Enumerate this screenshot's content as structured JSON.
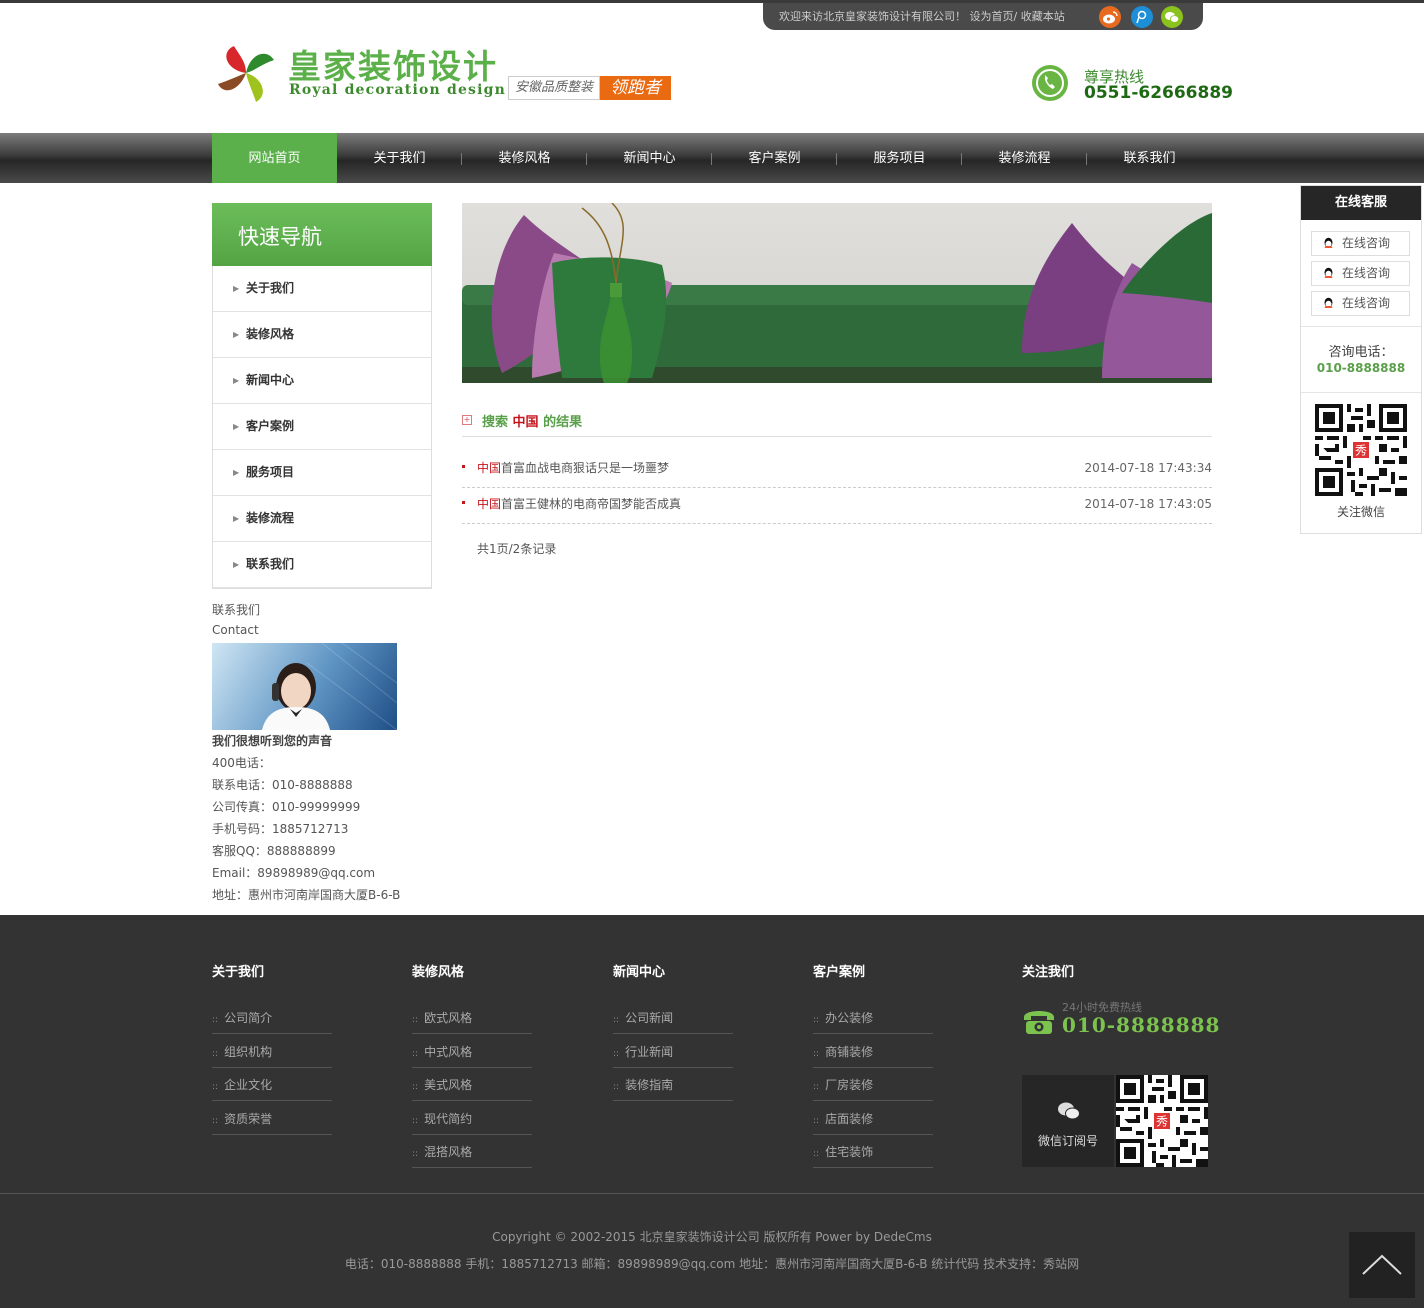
{
  "topbar": {
    "welcome": "欢迎来访北京皇家装饰设计有限公司！",
    "set_home": "设为首页",
    "sep": "/",
    "favorite": "收藏本站"
  },
  "header": {
    "brand_cn": "皇家装饰设计",
    "brand_en": "Royal decoration design",
    "slogan_a": "安徽品质整装",
    "slogan_b": "领跑者",
    "hotline_label": "尊享热线",
    "hotline_number": "0551-62666889"
  },
  "nav": {
    "items": [
      "网站首页",
      "关于我们",
      "装修风格",
      "新闻中心",
      "客户案例",
      "服务项目",
      "装修流程",
      "联系我们"
    ]
  },
  "quicknav": {
    "title": "快速导航",
    "items": [
      "关于我们",
      "装修风格",
      "新闻中心",
      "客户案例",
      "服务项目",
      "装修流程",
      "联系我们"
    ]
  },
  "contact": {
    "title_cn": "联系我们",
    "title_en": "Contact",
    "tagline": "我们很想听到您的声音",
    "line_400": "400电话：",
    "line_tel": "联系电话：010-8888888",
    "line_fax": "公司传真：010-99999999",
    "line_mobile": "手机号码：1885712713",
    "line_qq": "客服QQ：888888899",
    "line_email": "Email：89898989@qq.com",
    "line_addr": "地址：惠州市河南岸国商大厦B-6-B"
  },
  "search": {
    "prefix": "搜索",
    "keyword": "中国",
    "suffix": "的结果",
    "results": [
      {
        "keyword": "中国",
        "rest": "首富血战电商狠话只是一场噩梦",
        "date": "2014-07-18 17:43:34"
      },
      {
        "keyword": "中国",
        "rest": "首富王健林的电商帝国梦能否成真",
        "date": "2014-07-18 17:43:05"
      }
    ],
    "pager": "共1页/2条记录"
  },
  "service": {
    "title": "在线客服",
    "consult": [
      "在线咨询",
      "在线咨询",
      "在线咨询"
    ],
    "phone_label": "咨询电话：",
    "phone": "010-8888888",
    "wechat_label": "关注微信"
  },
  "footer": {
    "columns": [
      {
        "title": "关于我们",
        "links": [
          "公司简介",
          "组织机构",
          "企业文化",
          "资质荣誉"
        ]
      },
      {
        "title": "装修风格",
        "links": [
          "欧式风格",
          "中式风格",
          "美式风格",
          "现代简约",
          "混搭风格"
        ]
      },
      {
        "title": "新闻中心",
        "links": [
          "公司新闻",
          "行业新闻",
          "装修指南"
        ]
      },
      {
        "title": "客户案例",
        "links": [
          "办公装修",
          "商铺装修",
          "厂房装修",
          "店面装修",
          "住宅装饰"
        ]
      }
    ],
    "follow_title": "关注我们",
    "hotline_label": "24小时免费热线",
    "hotline_number": "010-8888888",
    "wechat_label": "微信订阅号",
    "bullet": "::"
  },
  "copyright": {
    "line1": "Copyright © 2002-2015 北京皇家装饰设计公司 版权所有 Power by DedeCms",
    "line2": "电话：010-8888888 手机：1885712713 邮箱：89898989@qq.com 地址：惠州市河南岸国商大厦B-6-B 统计代码 技术支持：秀站网"
  },
  "colors": {
    "brand_green": "#5cb04a",
    "accent_orange": "#ea6a12",
    "keyword_red": "#c5161d",
    "footer_bg": "#333333"
  },
  "icons": [
    "weibo-icon",
    "tencent-weibo-icon",
    "wechat-icon",
    "phone-icon",
    "arrow-icon",
    "qq-icon",
    "qr-code-icon",
    "back-to-top-icon"
  ]
}
